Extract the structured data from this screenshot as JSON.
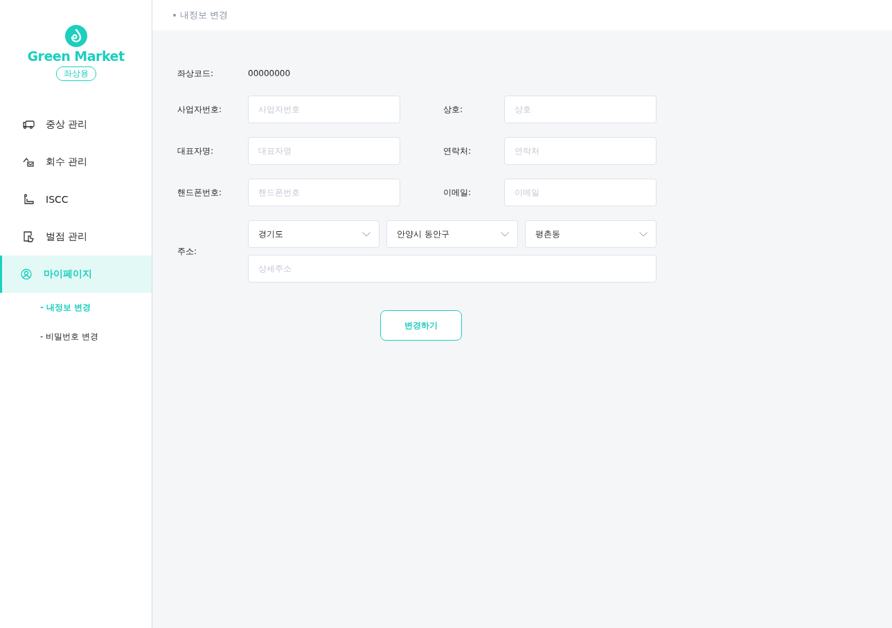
{
  "logo": {
    "name": "Green Market",
    "badge": "좌상용"
  },
  "nav": [
    {
      "label": "중상 관리",
      "selected": false
    },
    {
      "label": "회수 관리",
      "selected": false
    },
    {
      "label": "ISCC",
      "selected": false
    },
    {
      "label": "벌점 관리",
      "selected": false
    },
    {
      "label": "마이페이지",
      "selected": true,
      "children": [
        {
          "label": "- 내정보 변경",
          "selected": true
        },
        {
          "label": "- 비밀번호 변경",
          "selected": false
        }
      ]
    }
  ],
  "breadcrumb": "내정보 변경",
  "form": {
    "code": {
      "label": "좌상코드:",
      "value": "00000000"
    },
    "fields": [
      {
        "label": "사업자번호:",
        "placeholder": "사업자번호"
      },
      {
        "label": "상호:",
        "placeholder": "상호"
      },
      {
        "label": "대표자명:",
        "placeholder": "대표자명"
      },
      {
        "label": "연락처:",
        "placeholder": "연락처"
      },
      {
        "label": "핸드폰번호:",
        "placeholder": "핸드폰번호"
      },
      {
        "label": "이메일:",
        "placeholder": "이메일"
      }
    ],
    "address": {
      "label": "주소:",
      "selects": [
        {
          "value": "경기도"
        },
        {
          "value": "안양시 동안구"
        },
        {
          "value": "평촌동"
        }
      ],
      "detail": {
        "placeholder": "상세주소"
      }
    },
    "submit": "변경하기"
  }
}
